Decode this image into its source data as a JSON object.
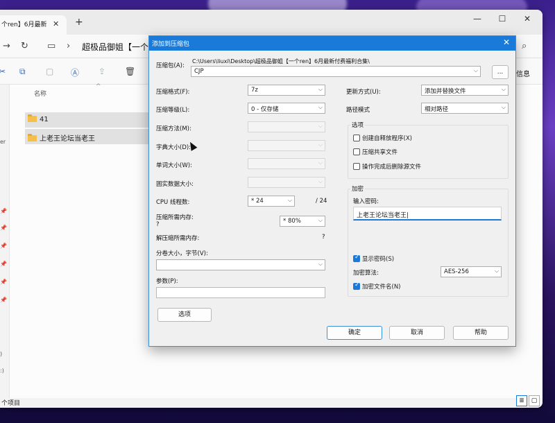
{
  "explorer": {
    "tab_title": "个ren】6月最新",
    "tab_close": "✕",
    "tab_add": "+",
    "minimize": "—",
    "maximize": "☐",
    "close": "✕",
    "breadcrumb": "超极品御姐【一个re",
    "column_name": "名称",
    "sort_indicator": "^",
    "toolbar_right": "信息",
    "sidebar_items": [
      "er",
      ")",
      ":)"
    ],
    "files": [
      {
        "name": "41"
      },
      {
        "name": "上老王论坛当老王"
      }
    ],
    "status": "个项目"
  },
  "dialog": {
    "title": "添加到压缩包",
    "archive_label": "压缩包(A):",
    "archive_path": "C:\\Users\\liuxi\\Desktop\\超极品御姐【一个ren】6月最新付费福利合集\\",
    "archive_name": "CJP",
    "browse_button": "...",
    "format_label": "压缩格式(F):",
    "format_value": "7z",
    "level_label": "压缩等级(L):",
    "level_value": "0 - 仅存储",
    "method_label": "压缩方法(M):",
    "dict_label": "字典大小(D):",
    "word_label": "单词大小(W):",
    "solid_label": "固实数据大小:",
    "cpu_label": "CPU 线程数:",
    "cpu_value": "* 24",
    "cpu_max": "/ 24",
    "mem_label": "压缩所需内存:",
    "mem_q": "?",
    "mem_value": "* 80%",
    "decomp_label": "解压缩所需内存:",
    "decomp_value": "?",
    "split_label": "分卷大小，字节(V):",
    "params_label": "参数(P):",
    "options_button": "选项",
    "update_label": "更新方式(U):",
    "update_value": "添加并替换文件",
    "path_label": "路径模式",
    "path_value": "相对路径",
    "options_group": "选项",
    "opt_sfx": "创建自释放程序(X)",
    "opt_shared": "压缩共享文件",
    "opt_delete": "操作完成后删除源文件",
    "encrypt_group": "加密",
    "pwd_label": "输入密码:",
    "pwd_value": "上老王论坛当老王|",
    "show_pwd": "显示密码(S)",
    "enc_method_label": "加密算法:",
    "enc_method_value": "AES-256",
    "enc_names": "加密文件名(N)",
    "ok": "确定",
    "cancel": "取消",
    "help": "帮助"
  }
}
